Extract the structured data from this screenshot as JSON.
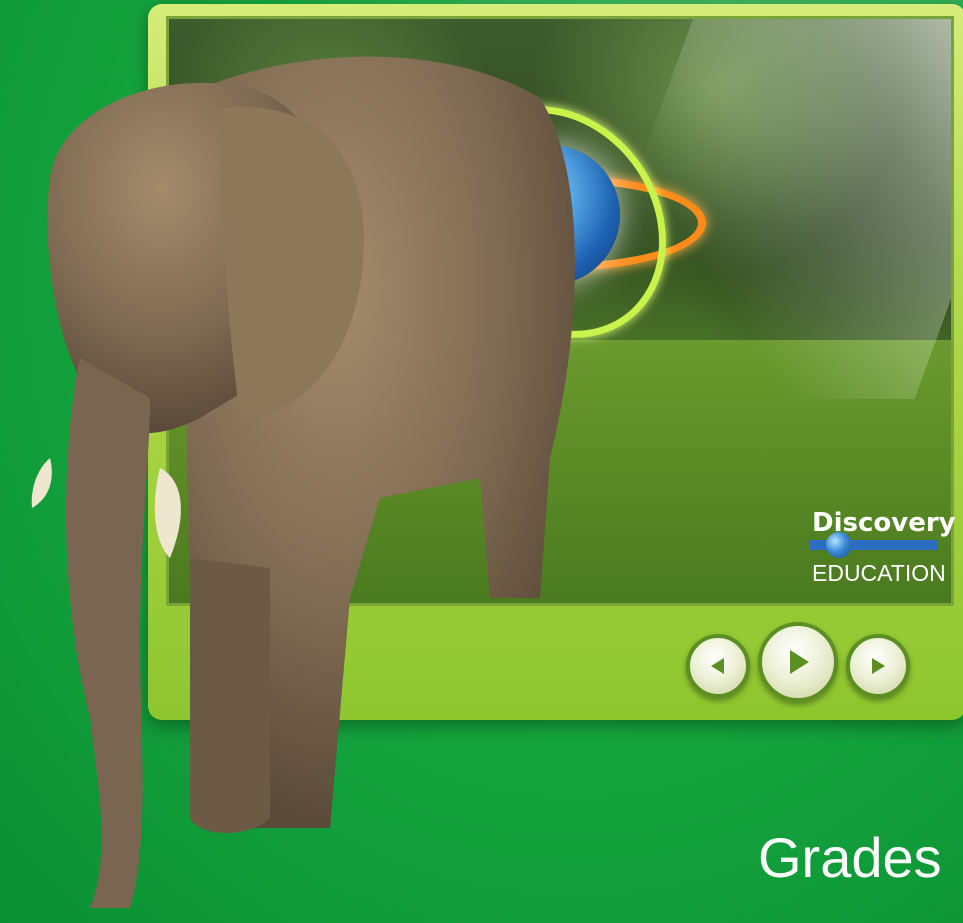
{
  "logo": {
    "brand_top": "Discovery",
    "brand_bottom": "EDUCATION"
  },
  "controls": {
    "prev_icon": "prev-arrow-icon",
    "play_icon": "play-icon",
    "next_icon": "next-arrow-icon"
  },
  "footer": {
    "grades_label": "Grades"
  },
  "colors": {
    "background_green": "#16a83f",
    "player_frame": "#b2d94a",
    "accent_blue": "#2c6dc4"
  }
}
